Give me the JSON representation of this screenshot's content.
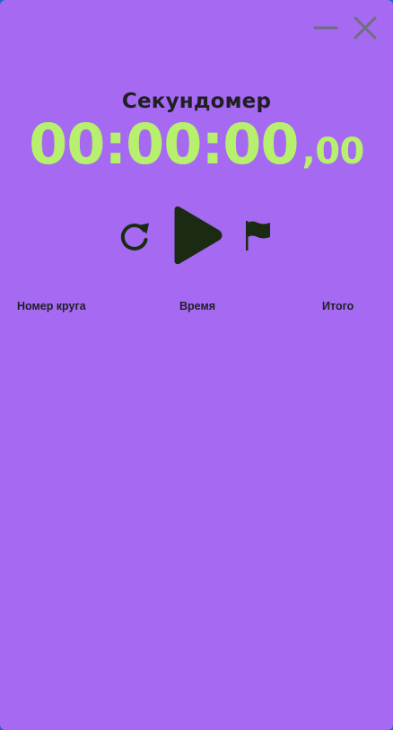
{
  "window": {
    "background": "#a569f2",
    "minimize_icon": "minimize-icon",
    "close_icon": "close-icon"
  },
  "title": "Секундомер",
  "display": {
    "main": "00:00:00",
    "fraction": ",00",
    "color": "#b7f06c"
  },
  "controls": {
    "reset_icon": "refresh-icon",
    "play_icon": "play-icon",
    "lap_icon": "flag-icon"
  },
  "laps": {
    "columns": [
      "Номер круга",
      "Время",
      "Итого"
    ],
    "rows": []
  }
}
